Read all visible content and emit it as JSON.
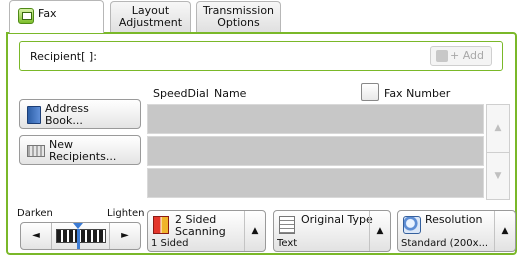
{
  "tabs": [
    {
      "label": "Fax",
      "icon": "fax-icon"
    },
    {
      "label": "Layout\nAdjustment"
    },
    {
      "label": "Transmission\nOptions"
    }
  ],
  "recipient": {
    "label": "Recipient[   ]:",
    "add_button": "+ Add",
    "add_icon": "add-recipient-icon"
  },
  "left_buttons": {
    "address_book": "Address\nBook...",
    "address_book_icon": "address-book-icon",
    "new_recipients": "New\nRecipients...",
    "new_recipients_icon": "keyboard-icon"
  },
  "list": {
    "col_speeddial": "SpeedDial",
    "col_name": "Name",
    "col_fax_number": "Fax Number",
    "rows": [
      "",
      "",
      ""
    ],
    "scroll_up_icon": "▲",
    "scroll_down_icon": "▼"
  },
  "darkness": {
    "darken_label": "Darken",
    "lighten_label": "Lighten",
    "left_arrow": "◄",
    "right_arrow": "►"
  },
  "features": [
    {
      "title": "2 Sided\nScanning",
      "value": "1 Sided",
      "arrow": "▲",
      "icon": "two-sided-icon"
    },
    {
      "title": "Original Type",
      "value": "Text",
      "arrow": "▲",
      "icon": "document-icon"
    },
    {
      "title": "Resolution",
      "value": "Standard (200x...",
      "arrow": "▲",
      "icon": "magnifier-icon"
    }
  ],
  "colors": {
    "accent_green": "#7ab829",
    "row_gray": "#c7c7c7",
    "slider_blue": "#3b7bd4"
  }
}
